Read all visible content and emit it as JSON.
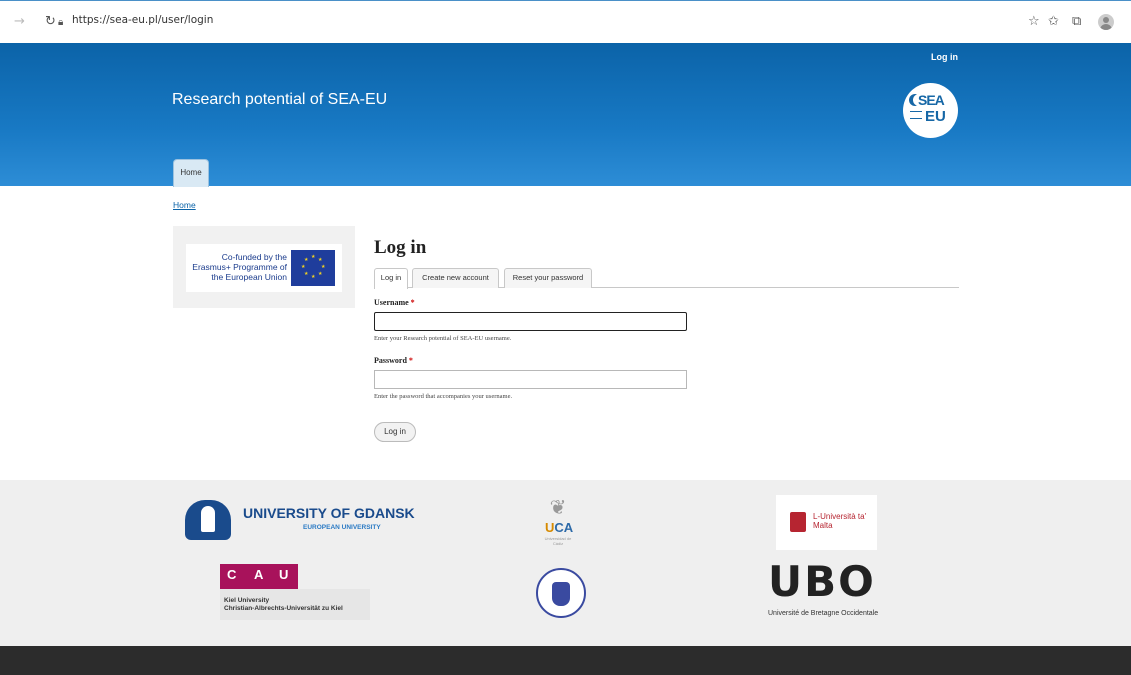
{
  "browser": {
    "url": "https://sea-eu.pl/user/login"
  },
  "header": {
    "top_login": "Log in",
    "site_title": "Research potential of SEA-EU",
    "logo_sea": "SEA",
    "logo_eu": "EU",
    "home_tab": "Home"
  },
  "breadcrumb": "Home",
  "sidebar": {
    "erasmus_text": "Co-funded by the Erasmus+ Programme of the European Union"
  },
  "form": {
    "title": "Log in",
    "tabs": [
      "Log in",
      "Create new account",
      "Reset your password"
    ],
    "username_label": "Username",
    "username_help": "Enter your Research potential of SEA-EU username.",
    "password_label": "Password",
    "password_help": "Enter the password that accompanies your username.",
    "required_mark": "*",
    "submit": "Log in"
  },
  "partners": {
    "gdansk_title": "UNIVERSITY OF GDANSK",
    "gdansk_sub": "EUROPEAN UNIVERSITY",
    "uca_u": "U",
    "uca_rest": "CA",
    "uca_sub": "Universidad de Cádiz",
    "malta": "L-Università ta' Malta",
    "cau_c": "C",
    "cau_a": "A",
    "cau_u": "U",
    "cau_line1": "Kiel University",
    "cau_line2": "Christian-Albrechts-Universität zu Kiel",
    "ubo": "UBO",
    "ubo_sub": "Université de Bretagne Occidentale"
  }
}
